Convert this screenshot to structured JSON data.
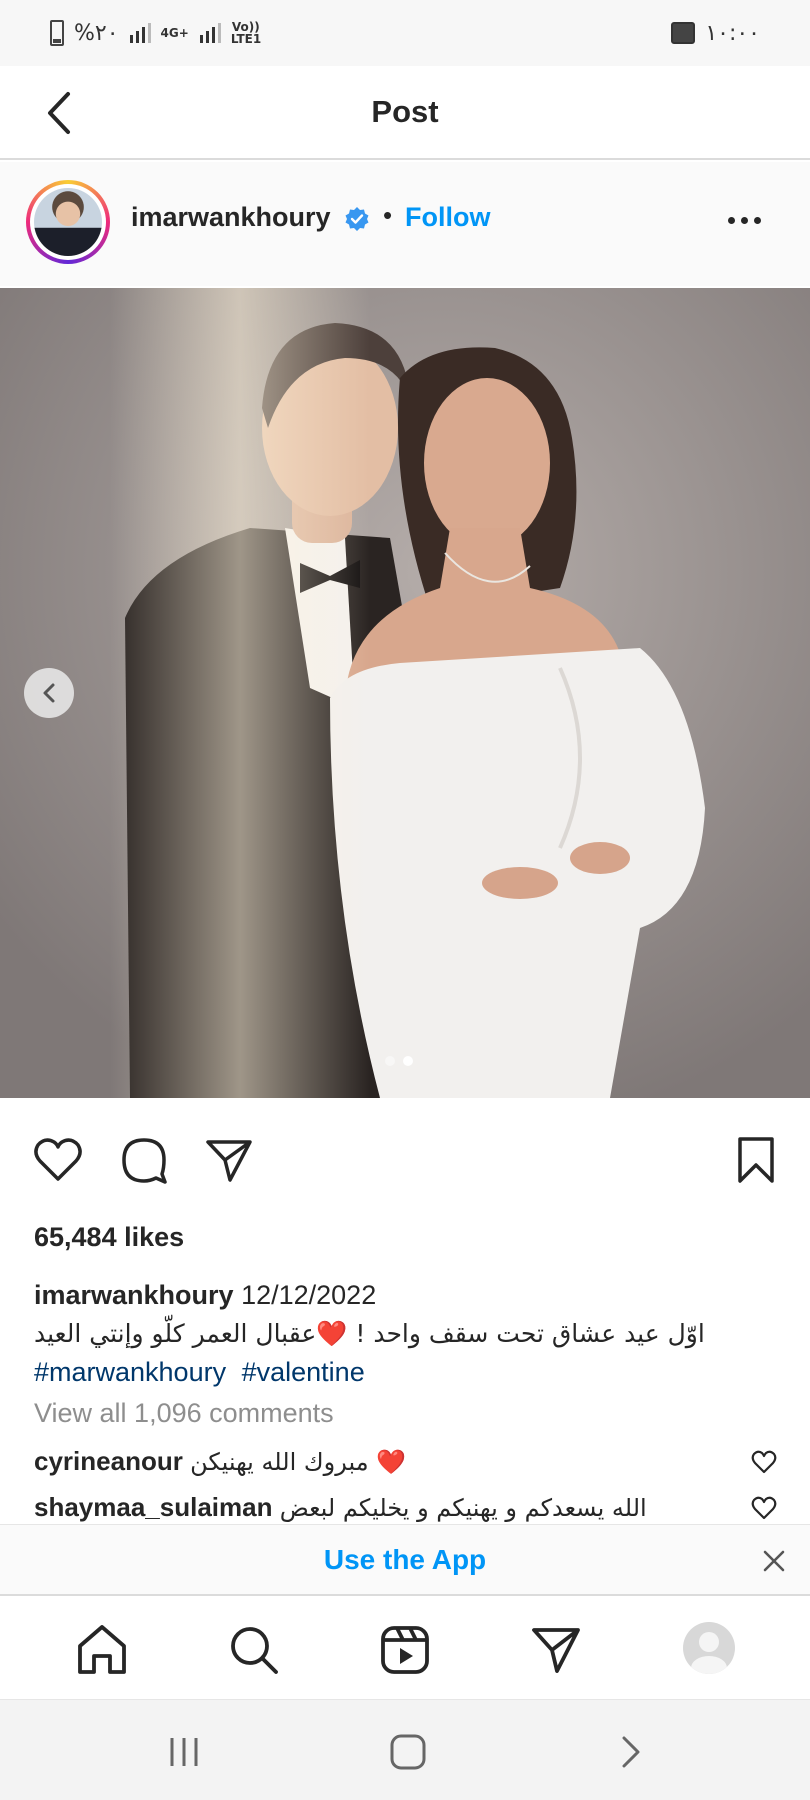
{
  "status_bar": {
    "battery_text": "%٢٠",
    "network_1": "4G+",
    "network_2": "Vo)) LTE1",
    "time": "١٠:٠٠"
  },
  "header": {
    "title": "Post"
  },
  "post": {
    "username": "imarwankhoury",
    "separator": "•",
    "follow_label": "Follow",
    "likes": "65,484 likes",
    "caption": {
      "user": "imarwankhoury",
      "date": "12/12/2022",
      "text": "اوّل عيد عشاق تحت سقف واحد ! ❤️عقبال العمر كلّو وإنتي العيد",
      "hashtags": [
        "#marwankhoury",
        "#valentine"
      ]
    },
    "view_all_comments": "View all 1,096 comments",
    "comments": [
      {
        "user": "cyrineanour",
        "text": "مبروك الله يهنيكن ❤️"
      },
      {
        "user": "shaymaa_sulaiman",
        "text": "الله يسعدكم و يهنيكم و يخليكم لبعض"
      }
    ],
    "carousel": {
      "current": 2,
      "total": 2
    }
  },
  "banner": {
    "use_app_label": "Use the App"
  },
  "icons": {
    "verified": "verified-badge-icon",
    "like": "heart-icon",
    "comment": "comment-icon",
    "share": "share-icon",
    "save": "bookmark-icon"
  },
  "colors": {
    "accent": "#0095f6",
    "text": "#262626",
    "muted": "#8e8e8e",
    "hashtag": "#00376b",
    "heart": "#e0102d"
  }
}
